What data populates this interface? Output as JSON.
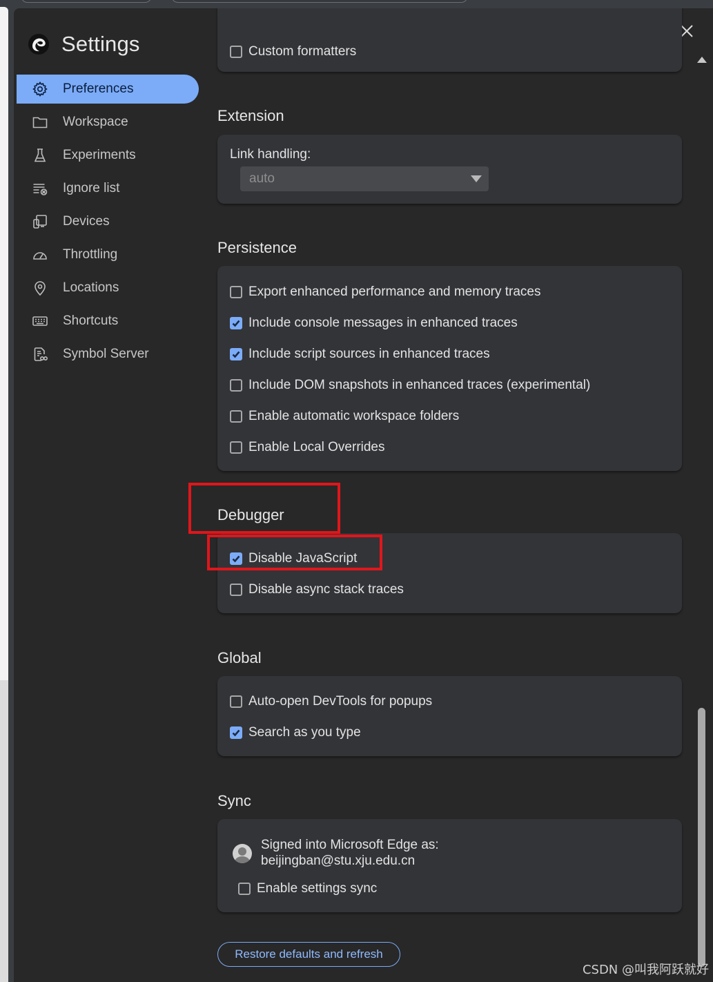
{
  "app": {
    "title": "Settings"
  },
  "sidebar": {
    "items": [
      {
        "label": "Preferences",
        "icon": "gear-icon",
        "active": true
      },
      {
        "label": "Workspace",
        "icon": "folder-icon"
      },
      {
        "label": "Experiments",
        "icon": "flask-icon"
      },
      {
        "label": "Ignore list",
        "icon": "ignore-list-icon"
      },
      {
        "label": "Devices",
        "icon": "devices-icon"
      },
      {
        "label": "Throttling",
        "icon": "speedometer-icon"
      },
      {
        "label": "Locations",
        "icon": "location-pin-icon"
      },
      {
        "label": "Shortcuts",
        "icon": "keyboard-icon"
      },
      {
        "label": "Symbol Server",
        "icon": "symbol-server-icon"
      }
    ]
  },
  "top_partial": {
    "label": "Custom formatters",
    "checked": false
  },
  "extension": {
    "title": "Extension",
    "link_label": "Link handling:",
    "link_value": "auto"
  },
  "persistence": {
    "title": "Persistence",
    "options": [
      {
        "label": "Export enhanced performance and memory traces",
        "checked": false
      },
      {
        "label": "Include console messages in enhanced traces",
        "checked": true
      },
      {
        "label": "Include script sources in enhanced traces",
        "checked": true
      },
      {
        "label": "Include DOM snapshots in enhanced traces (experimental)",
        "checked": false
      },
      {
        "label": "Enable automatic workspace folders",
        "checked": false
      },
      {
        "label": "Enable Local Overrides",
        "checked": false
      }
    ]
  },
  "debugger": {
    "title": "Debugger",
    "options": [
      {
        "label": "Disable JavaScript",
        "checked": true
      },
      {
        "label": "Disable async stack traces",
        "checked": false
      }
    ]
  },
  "global": {
    "title": "Global",
    "options": [
      {
        "label": "Auto-open DevTools for popups",
        "checked": false
      },
      {
        "label": "Search as you type",
        "checked": true
      }
    ]
  },
  "sync": {
    "title": "Sync",
    "signed_line1": "Signed into Microsoft Edge as:",
    "signed_line2": "beijingban@stu.xju.edu.cn",
    "option": {
      "label": "Enable settings sync",
      "checked": false
    }
  },
  "restore_label": "Restore defaults and refresh",
  "watermark": "CSDN @叫我阿跃就好",
  "colors": {
    "accent": "#7cacf8",
    "highlight": "#e0161b",
    "panel": "#333438",
    "background": "#282828"
  }
}
